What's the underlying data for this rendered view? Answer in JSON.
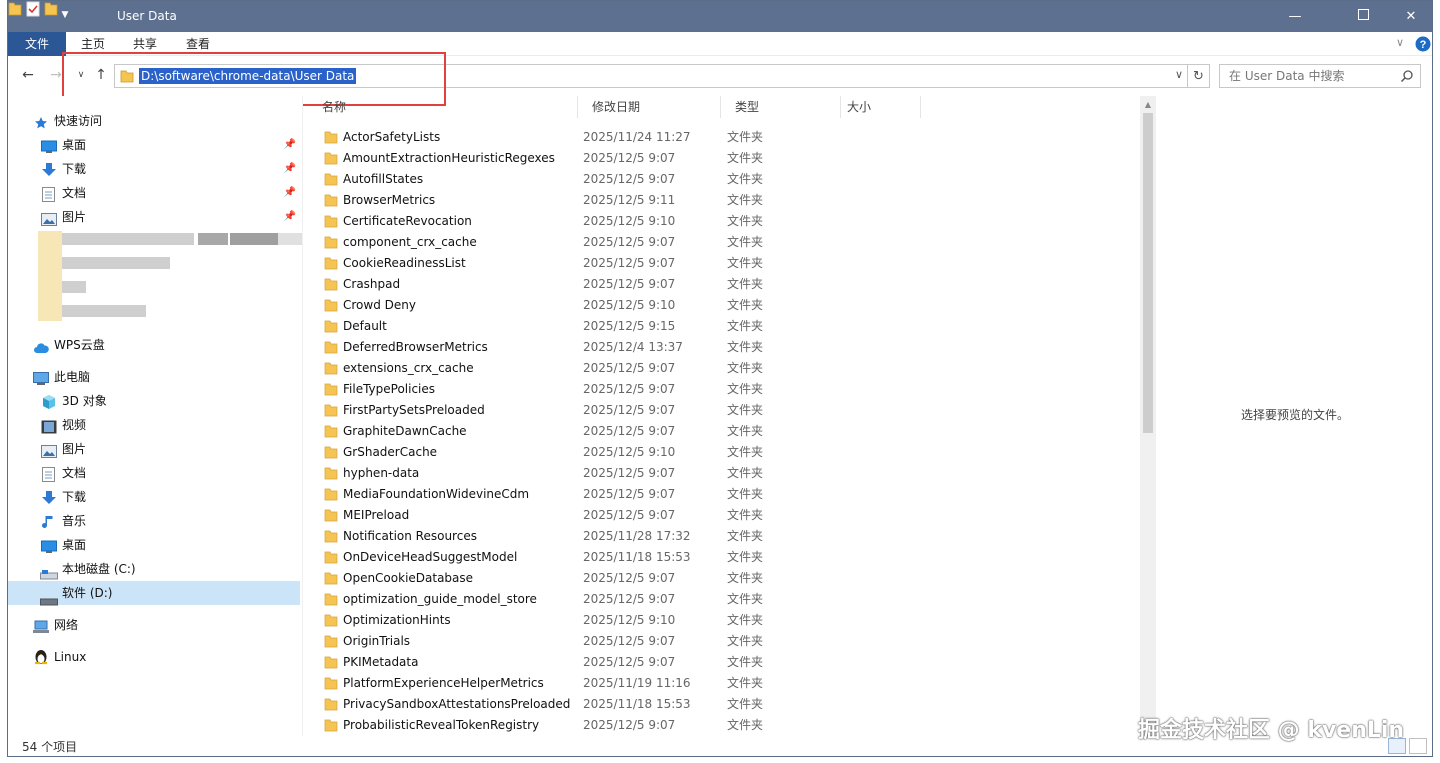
{
  "window": {
    "title": "User Data",
    "colors": {
      "titlebar": "#5d708f",
      "file_tab": "#2b5797",
      "selection": "#2a62c9",
      "folder": "#f5c452"
    }
  },
  "ribbon": {
    "tabs": [
      {
        "label": "文件"
      },
      {
        "label": "主页"
      },
      {
        "label": "共享"
      },
      {
        "label": "查看"
      }
    ]
  },
  "nav": {
    "address": "D:\\software\\chrome-data\\User Data",
    "search_placeholder": "在 User Data 中搜索"
  },
  "sidebar": {
    "quick_access": "快速访问",
    "quick_items": [
      {
        "label": "桌面",
        "icon": "desktop-icon"
      },
      {
        "label": "下载",
        "icon": "download-icon"
      },
      {
        "label": "文档",
        "icon": "document-icon"
      },
      {
        "label": "图片",
        "icon": "picture-icon"
      }
    ],
    "wps": "WPS云盘",
    "this_pc": "此电脑",
    "pc_items": [
      {
        "label": "3D 对象",
        "icon": "3d-objects-icon"
      },
      {
        "label": "视频",
        "icon": "video-icon"
      },
      {
        "label": "图片",
        "icon": "picture-icon"
      },
      {
        "label": "文档",
        "icon": "document-icon"
      },
      {
        "label": "下载",
        "icon": "download-icon"
      },
      {
        "label": "音乐",
        "icon": "music-icon"
      },
      {
        "label": "桌面",
        "icon": "desktop-icon"
      },
      {
        "label": "本地磁盘 (C:)",
        "icon": "drive-icon"
      },
      {
        "label": "软件 (D:)",
        "icon": "drive-icon"
      }
    ],
    "network": "网络",
    "linux": "Linux"
  },
  "columns": {
    "name": "名称",
    "date": "修改日期",
    "type": "类型",
    "size": "大小"
  },
  "files": [
    {
      "name": "ActorSafetyLists",
      "date": "2025/11/24 11:27",
      "type": "文件夹"
    },
    {
      "name": "AmountExtractionHeuristicRegexes",
      "date": "2025/12/5 9:07",
      "type": "文件夹"
    },
    {
      "name": "AutofillStates",
      "date": "2025/12/5 9:07",
      "type": "文件夹"
    },
    {
      "name": "BrowserMetrics",
      "date": "2025/12/5 9:11",
      "type": "文件夹"
    },
    {
      "name": "CertificateRevocation",
      "date": "2025/12/5 9:10",
      "type": "文件夹"
    },
    {
      "name": "component_crx_cache",
      "date": "2025/12/5 9:07",
      "type": "文件夹"
    },
    {
      "name": "CookieReadinessList",
      "date": "2025/12/5 9:07",
      "type": "文件夹"
    },
    {
      "name": "Crashpad",
      "date": "2025/12/5 9:07",
      "type": "文件夹"
    },
    {
      "name": "Crowd Deny",
      "date": "2025/12/5 9:10",
      "type": "文件夹"
    },
    {
      "name": "Default",
      "date": "2025/12/5 9:15",
      "type": "文件夹"
    },
    {
      "name": "DeferredBrowserMetrics",
      "date": "2025/12/4 13:37",
      "type": "文件夹"
    },
    {
      "name": "extensions_crx_cache",
      "date": "2025/12/5 9:07",
      "type": "文件夹"
    },
    {
      "name": "FileTypePolicies",
      "date": "2025/12/5 9:07",
      "type": "文件夹"
    },
    {
      "name": "FirstPartySetsPreloaded",
      "date": "2025/12/5 9:07",
      "type": "文件夹"
    },
    {
      "name": "GraphiteDawnCache",
      "date": "2025/12/5 9:07",
      "type": "文件夹"
    },
    {
      "name": "GrShaderCache",
      "date": "2025/12/5 9:10",
      "type": "文件夹"
    },
    {
      "name": "hyphen-data",
      "date": "2025/12/5 9:07",
      "type": "文件夹"
    },
    {
      "name": "MediaFoundationWidevineCdm",
      "date": "2025/12/5 9:07",
      "type": "文件夹"
    },
    {
      "name": "MEIPreload",
      "date": "2025/12/5 9:07",
      "type": "文件夹"
    },
    {
      "name": "Notification Resources",
      "date": "2025/11/28 17:32",
      "type": "文件夹"
    },
    {
      "name": "OnDeviceHeadSuggestModel",
      "date": "2025/11/18 15:53",
      "type": "文件夹"
    },
    {
      "name": "OpenCookieDatabase",
      "date": "2025/12/5 9:07",
      "type": "文件夹"
    },
    {
      "name": "optimization_guide_model_store",
      "date": "2025/12/5 9:07",
      "type": "文件夹"
    },
    {
      "name": "OptimizationHints",
      "date": "2025/12/5 9:10",
      "type": "文件夹"
    },
    {
      "name": "OriginTrials",
      "date": "2025/12/5 9:07",
      "type": "文件夹"
    },
    {
      "name": "PKIMetadata",
      "date": "2025/12/5 9:07",
      "type": "文件夹"
    },
    {
      "name": "PlatformExperienceHelperMetrics",
      "date": "2025/11/19 11:16",
      "type": "文件夹"
    },
    {
      "name": "PrivacySandboxAttestationsPreloaded",
      "date": "2025/11/18 15:53",
      "type": "文件夹"
    },
    {
      "name": "ProbabilisticRevealTokenRegistry",
      "date": "2025/12/5 9:07",
      "type": "文件夹"
    }
  ],
  "preview": {
    "message": "选择要预览的文件。"
  },
  "status": {
    "count": "54 个项目"
  },
  "watermark": "掘金技术社区 @ kvenLin"
}
